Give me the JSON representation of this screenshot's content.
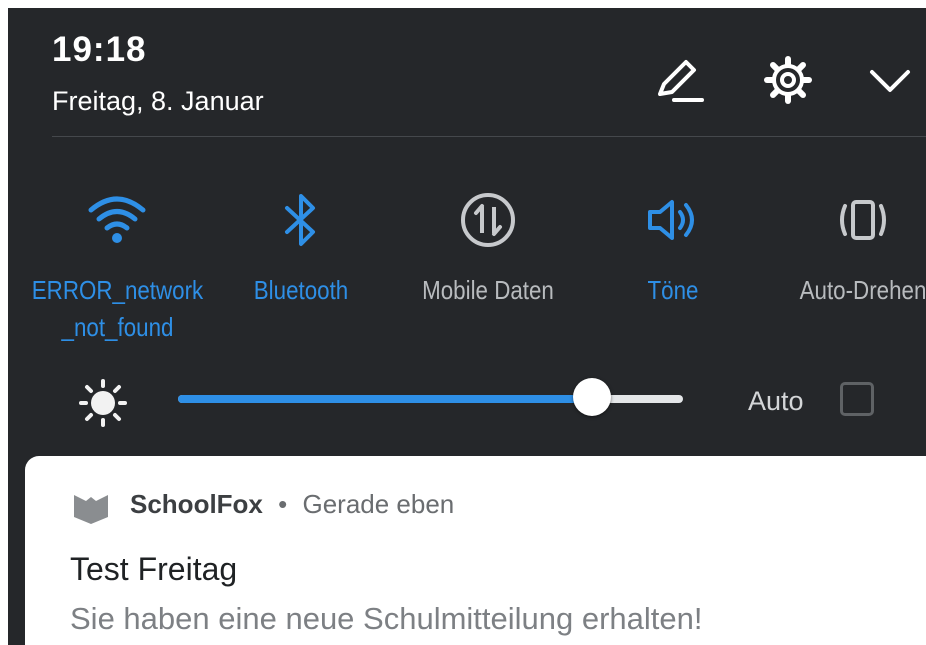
{
  "header": {
    "time": "19:18",
    "date": "Freitag, 8. Januar"
  },
  "icons": {
    "edit": "pencil-icon",
    "settings": "gear-icon",
    "expand": "chevron-down-icon"
  },
  "tiles": [
    {
      "label": "ERROR_network_not_found",
      "icon": "wifi-icon",
      "active": true
    },
    {
      "label": "Bluetooth",
      "icon": "bluetooth-icon",
      "active": true
    },
    {
      "label": "Mobile Daten",
      "icon": "mobile-data-icon",
      "active": false
    },
    {
      "label": "Töne",
      "icon": "speaker-icon",
      "active": true
    },
    {
      "label": "Auto-Drehen",
      "icon": "auto-rotate-icon",
      "active": false
    }
  ],
  "brightness": {
    "level": 0.82,
    "auto_label": "Auto",
    "auto_checked": false
  },
  "notification": {
    "app_name": "SchoolFox",
    "separator": "•",
    "time": "Gerade eben",
    "title": "Test Freitag",
    "body": "Sie haben eine neue Schulmitteilung erhalten!"
  },
  "colors": {
    "accent": "#2e8fe6",
    "panel_bg": "#25272a",
    "inactive": "#b8bbbe"
  }
}
